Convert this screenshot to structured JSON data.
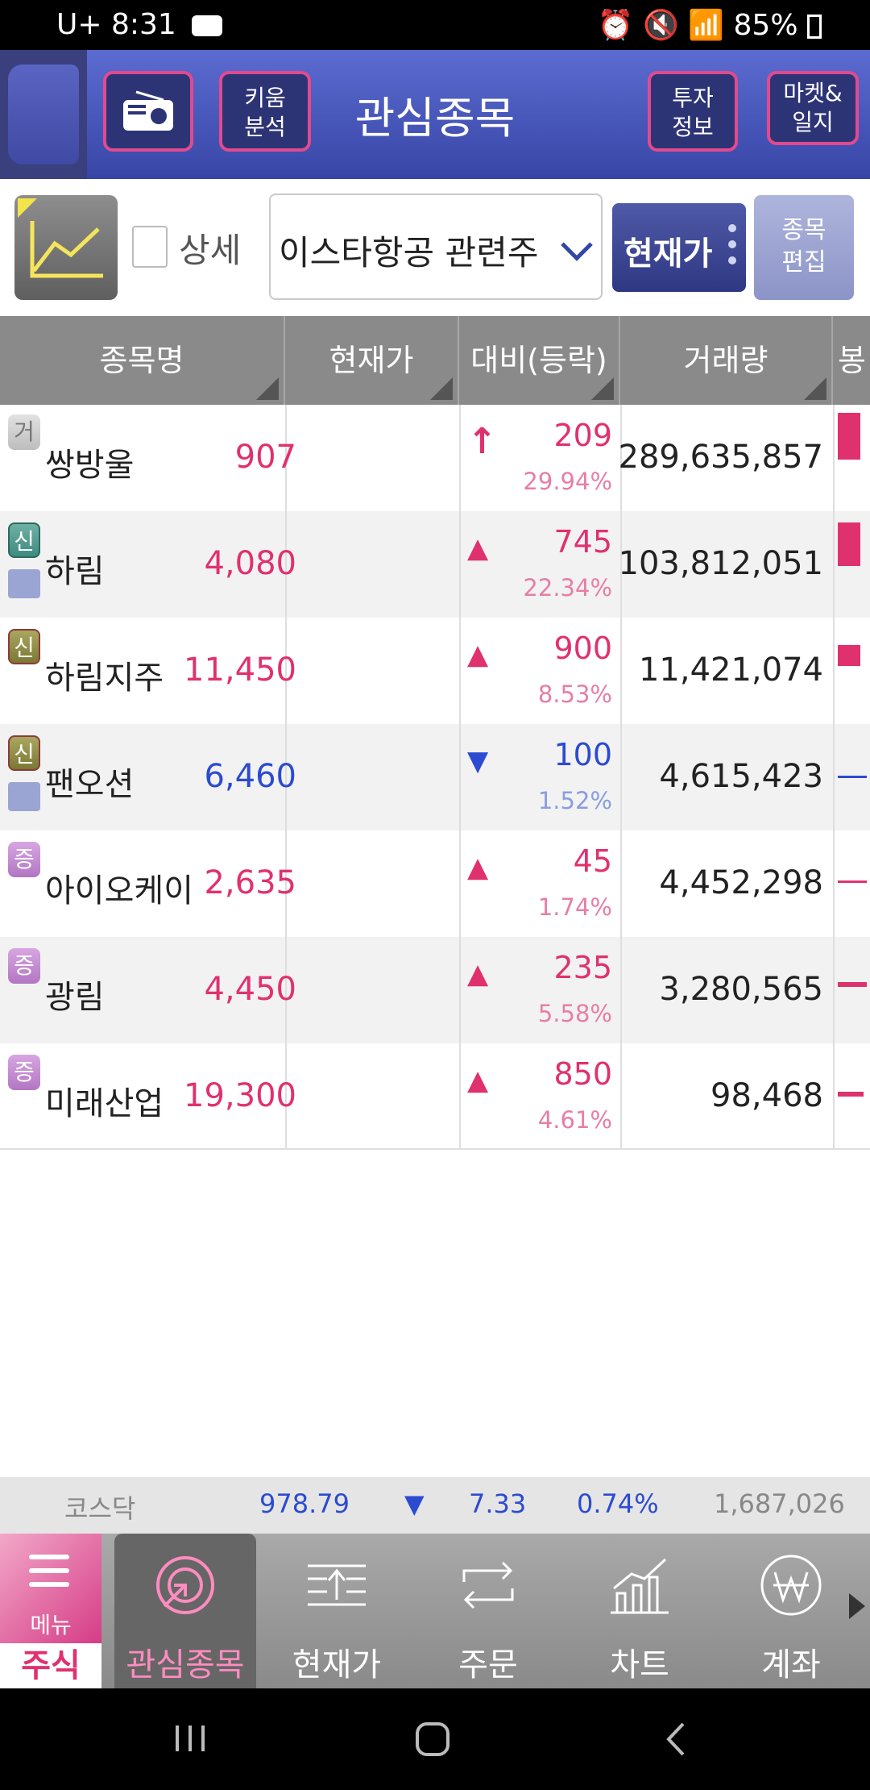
{
  "status": {
    "carrier": "U+",
    "time": "8:31",
    "battery": "85%"
  },
  "header": {
    "title": "관심종목",
    "kiwoom_analysis": [
      "키움",
      "분석"
    ],
    "invest_info": [
      "투자",
      "정보"
    ],
    "market_diary": [
      "마켓&",
      "일지"
    ]
  },
  "toolbar": {
    "detail_label": "상세",
    "group_value": "이스타항공 관련주",
    "price_button": "현재가",
    "edit_button": [
      "종목",
      "편집"
    ]
  },
  "table": {
    "columns": [
      "종목명",
      "현재가",
      "대비(등락)",
      "거래량",
      "봉"
    ],
    "rows": [
      {
        "badge": "거",
        "badge_style": "gray",
        "edit_icon": false,
        "name": "쌍방울",
        "price": "907",
        "dir": "up-limit",
        "arrow": "↑",
        "change": "209",
        "pct": "29.94%",
        "volume": "289,635,857"
      },
      {
        "badge": "신",
        "badge_style": "green",
        "edit_icon": true,
        "name": "하림",
        "price": "4,080",
        "dir": "up",
        "arrow": "▲",
        "change": "745",
        "pct": "22.34%",
        "volume": "103,812,051"
      },
      {
        "badge": "신",
        "badge_style": "olive",
        "edit_icon": false,
        "name": "하림지주",
        "price": "11,450",
        "dir": "up",
        "arrow": "▲",
        "change": "900",
        "pct": "8.53%",
        "volume": "11,421,074"
      },
      {
        "badge": "신",
        "badge_style": "olive",
        "edit_icon": true,
        "name": "팬오션",
        "price": "6,460",
        "dir": "down",
        "arrow": "▼",
        "change": "100",
        "pct": "1.52%",
        "volume": "4,615,423"
      },
      {
        "badge": "증",
        "badge_style": "purple",
        "edit_icon": false,
        "name": "아이오케이",
        "price": "2,635",
        "dir": "up",
        "arrow": "▲",
        "change": "45",
        "pct": "1.74%",
        "volume": "4,452,298"
      },
      {
        "badge": "증",
        "badge_style": "purple",
        "edit_icon": false,
        "name": "광림",
        "price": "4,450",
        "dir": "up",
        "arrow": "▲",
        "change": "235",
        "pct": "5.58%",
        "volume": "3,280,565"
      },
      {
        "badge": "증",
        "badge_style": "purple",
        "edit_icon": false,
        "name": "미래산업",
        "price": "19,300",
        "dir": "up",
        "arrow": "▲",
        "change": "850",
        "pct": "4.61%",
        "volume": "98,468"
      }
    ]
  },
  "index": {
    "name": "코스닥",
    "value": "978.79",
    "arrow": "▼",
    "change": "7.33",
    "pct": "0.74%",
    "volume": "1,687,026"
  },
  "nav": {
    "menu_label": "메뉴",
    "stock_label": "주식",
    "items": [
      "관심종목",
      "현재가",
      "주문",
      "차트",
      "계좌"
    ]
  },
  "colors": {
    "up": "#e0316f",
    "down": "#2c4bd0",
    "header": "#3f4fb3",
    "accent": "#e24a8e"
  }
}
